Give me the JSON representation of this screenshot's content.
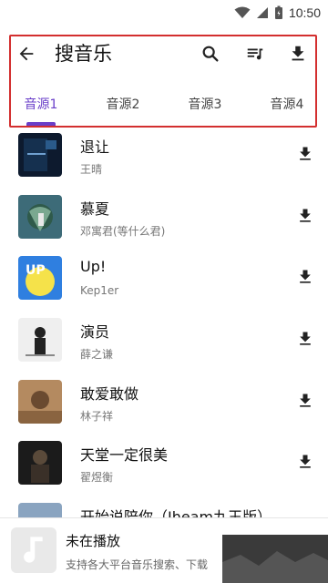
{
  "status_bar": {
    "time": "10:50",
    "icons": [
      "wifi-icon",
      "signal-icon",
      "battery-icon"
    ]
  },
  "toolbar": {
    "title": "搜音乐",
    "icons": [
      "back-arrow-icon",
      "search-icon",
      "playlist-icon",
      "download-icon"
    ]
  },
  "tabs": [
    {
      "label": "音源1",
      "active": true
    },
    {
      "label": "音源2",
      "active": false
    },
    {
      "label": "音源3",
      "active": false
    },
    {
      "label": "音源4",
      "active": false
    }
  ],
  "songs": [
    {
      "title": "退让",
      "artist": "王晴"
    },
    {
      "title": "慕夏",
      "artist": "邓寓君(等什么君)"
    },
    {
      "title": "Up!",
      "artist": "Kep1er"
    },
    {
      "title": "演员",
      "artist": "薛之谦"
    },
    {
      "title": "敢爱敢做",
      "artist": "林子祥"
    },
    {
      "title": "天堂一定很美",
      "artist": "翟煜衡"
    },
    {
      "title": "开始说陪你（Jheam九王版）",
      "artist": ""
    }
  ],
  "player": {
    "title": "未在播放",
    "subtitle": "支持各大平台音乐搜索、下载"
  },
  "colors": {
    "accent": "#6a3fc9",
    "highlight_border": "#d32f2f",
    "text_primary": "#111111",
    "text_secondary": "#777777"
  }
}
